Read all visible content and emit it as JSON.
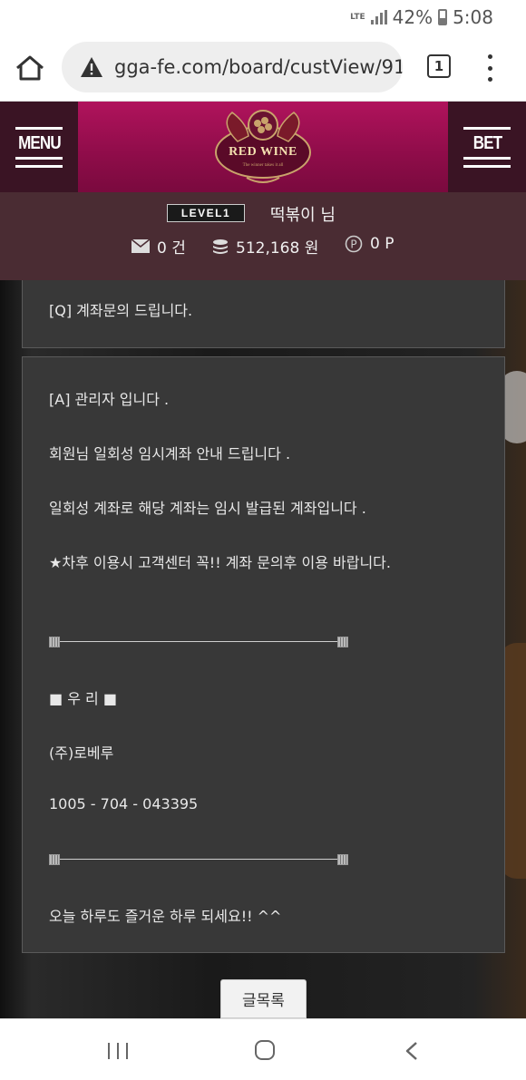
{
  "status_bar": {
    "network": "LTE",
    "battery": "42%",
    "time": "5:08"
  },
  "browser": {
    "url": "gga-fe.com/board/custView/91:",
    "tab_count": "1",
    "icons": [
      "home-icon",
      "warning-icon",
      "tabs-icon",
      "more-vert-icon"
    ]
  },
  "header": {
    "menu_label": "MENU",
    "bet_label": "BET",
    "logo_text": "RED WINE",
    "logo_tagline": "The winner takes it all",
    "colors": {
      "header_bg": "#3a1424",
      "banner": "#a0105a",
      "user_bg": "#4a2c33"
    }
  },
  "user": {
    "level": "LEVEL1",
    "nickname": "떡볶이 님",
    "messages": "0 건",
    "money": "512,168 원",
    "points": "0 P"
  },
  "post": {
    "question": "[Q] 계좌문의 드립니다.",
    "answer_lines": [
      "[A] 관리자 입니다 .",
      "회원님 일회성 임시계좌 안내 드립니다 .",
      "일회성 계좌로 해당 계좌는 임시 발급된 계좌입니다 .",
      "★차후 이용시 고객센터 꼭!! 계좌 문의후 이용 바랍니다.",
      "■ 우 리 ■",
      "(주)로베루",
      "1005 - 704 - 043395",
      "오늘 하루도 즐거운 하루 되세요!! ^^"
    ]
  },
  "list_button": "글목록"
}
